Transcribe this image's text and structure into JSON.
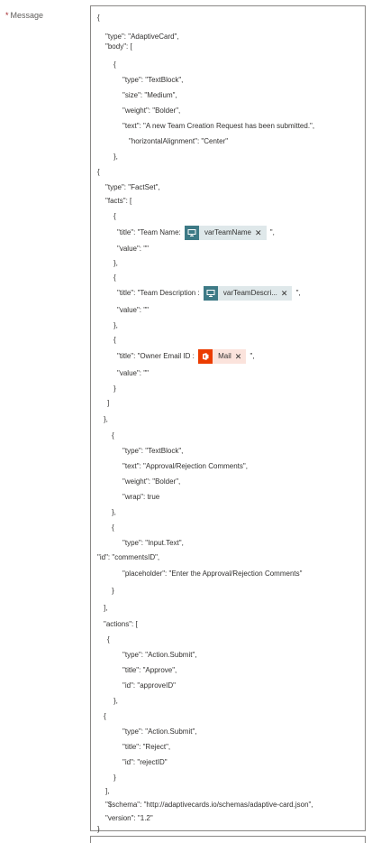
{
  "field": {
    "required_marker": "*",
    "label": "Message"
  },
  "lines": [
    "{",
    "\"type\": \"AdaptiveCard\",",
    "\"body\": [",
    "{",
    "\"type\": \"TextBlock\",",
    "\"size\": \"Medium\",",
    "\"weight\": \"Bolder\",",
    "\"text\": \"A new Team Creation Request has been submitted.\",",
    "\"horizontalAlignment\": \"Center\"",
    "},",
    "{",
    "\"type\": \"FactSet\",",
    "\"facts\": [",
    "{",
    "\"value\": \"\"",
    "},",
    "{",
    "\"value\": \"\"",
    "},",
    "{",
    "\"value\": \"\"",
    "}",
    "]",
    "},",
    "{",
    "\"type\": \"TextBlock\",",
    "\"text\": \"Approval/Rejection Comments\",",
    "\"weight\": \"Bolder\",",
    "\"wrap\": true",
    "},",
    "{",
    "\"type\": \"Input.Text\",",
    "\"id\": \"commentsID\",",
    "\"placeholder\": \"Enter the Approval/Rejection Comments\"",
    "}",
    "],",
    "\"actions\": [",
    "{",
    "\"type\": \"Action.Submit\",",
    "\"title\": \"Approve\",",
    "\"id\": \"approveID\"",
    "},",
    "{",
    "\"type\": \"Action.Submit\",",
    "\"title\": \"Reject\",",
    "\"id\": \"rejectID\"",
    "}",
    "],",
    "\"$schema\": \"http://adaptivecards.io/schemas/adaptive-card.json\",",
    "\"version\": \"1.2\"",
    "}"
  ],
  "token_lines": [
    {
      "prefix": "\"title\": \"Team Name: ",
      "token": "varTeamName",
      "suffix": " \",",
      "kind": "variable",
      "icon": "variable-icon"
    },
    {
      "prefix": "\"title\": \"Team Description : ",
      "token": "varTeamDescri...",
      "suffix": " \",",
      "kind": "variable",
      "icon": "variable-icon"
    },
    {
      "prefix": "\"title\": \"Owner Email ID : ",
      "token": "Mail",
      "suffix": " \",",
      "kind": "office365",
      "icon": "office-icon"
    }
  ],
  "colors": {
    "variable_token_bg": "#dfe8ea",
    "variable_icon_bg": "#3d7a86",
    "office_token_bg": "#fbe3dc",
    "office_icon_bg": "#eb3c00",
    "required": "#a4262c"
  }
}
